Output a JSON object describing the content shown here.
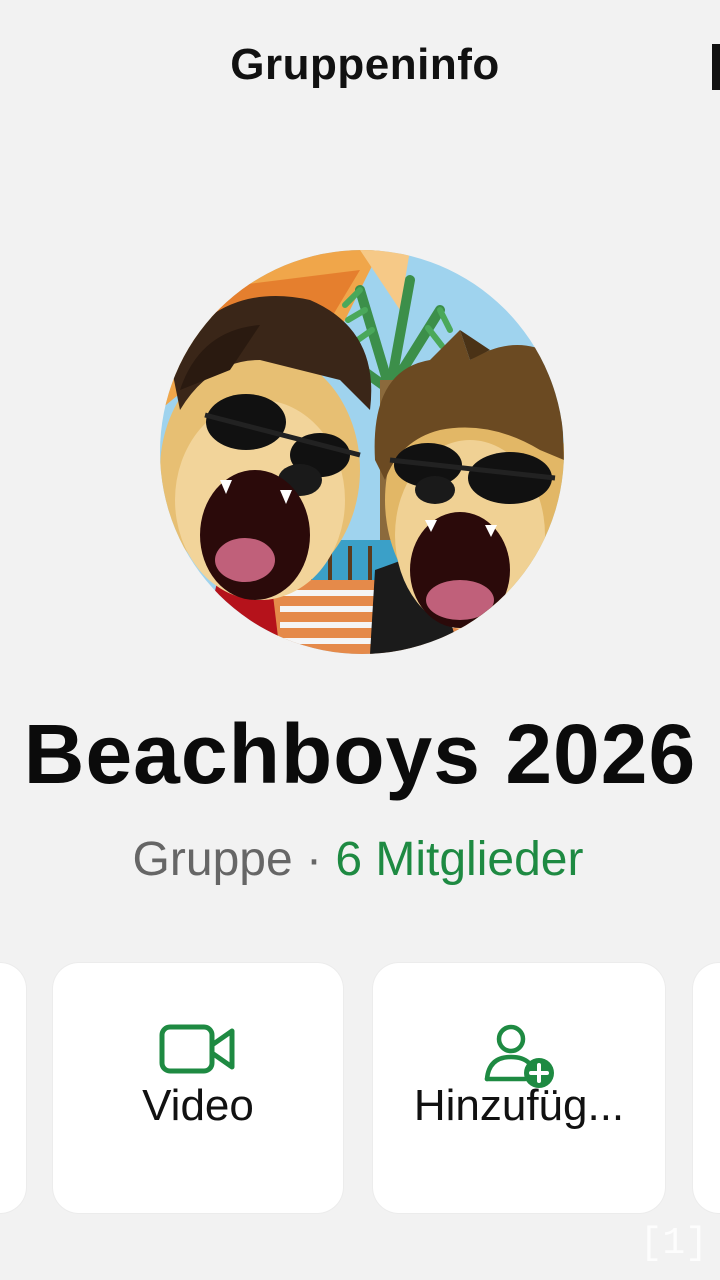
{
  "header": {
    "title": "Gruppeninfo"
  },
  "group": {
    "name": "Beachboys 2026",
    "type": "Gruppe",
    "separator": "·",
    "members": "6 Mitglieder",
    "avatar_description_icon": "group-avatar-image"
  },
  "actions": [
    {
      "label": "Video",
      "icon": "video-camera-icon"
    },
    {
      "label": "Hinzufüg...",
      "icon": "add-person-icon"
    }
  ],
  "watermark": "[1]",
  "colors": {
    "accent": "#1e8a42",
    "background": "#f2f2f2",
    "card": "#ffffff"
  }
}
